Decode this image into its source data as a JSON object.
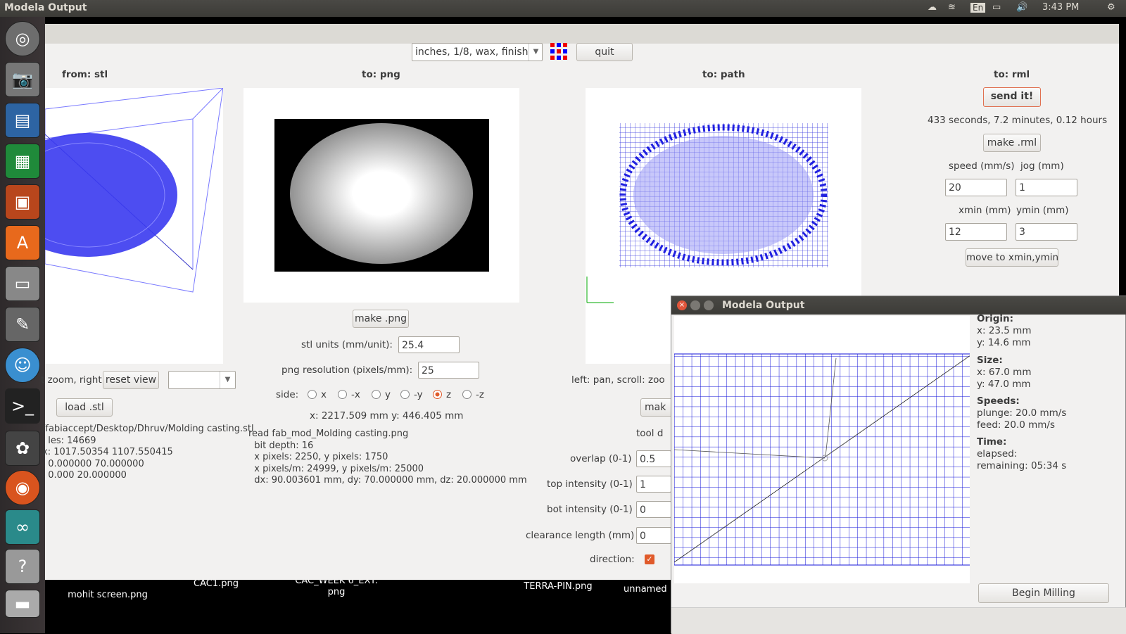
{
  "topbar": {
    "title": "Modela Output",
    "lang": "En",
    "time": "3:43 PM"
  },
  "main": {
    "top_select": "inches, 1/8, wax, finish",
    "quit": "quit",
    "col_stl": "from: stl",
    "col_png": "to: png",
    "col_path": "to: path",
    "col_rml": "to: rml",
    "stl": {
      "rotate_hint": "t zoom, right: rotate",
      "reset_view": "reset view",
      "load": "load .stl",
      "info_lines": [
        "/fabiaccept/Desktop/Dhruv/Molding casting.stl",
        "  les: 14669",
        "x: 1017.50354 1107.550415",
        "  0.000000 70.000000",
        "  0.000 20.000000"
      ]
    },
    "png": {
      "make": "make .png",
      "units_label": "stl units (mm/unit):",
      "units_value": "25.4",
      "res_label": "png resolution (pixels/mm):",
      "res_value": "25",
      "side_label": "side:",
      "sides": [
        "x",
        "-x",
        "y",
        "-y",
        "z",
        "-z"
      ],
      "coords": "x: 2217.509 mm  y: 446.405 mm",
      "info_lines": [
        "read fab_mod_Molding casting.png",
        "  bit depth: 16",
        "  x pixels: 2250, y pixels: 1750",
        "  x pixels/m: 24999, y pixels/m: 25000",
        "  dx: 90.003601 mm, dy: 70.000000 mm, dz: 20.000000 mm"
      ]
    },
    "path": {
      "hint": "left: pan, scroll: zoo",
      "make": "mak",
      "tool": "tool d",
      "overlap_label": "overlap (0-1)",
      "overlap": "0.5",
      "top_label": "top intensity (0-1)",
      "top": "1",
      "bot_label": "bot intensity (0-1)",
      "bot": "0",
      "clear_label": "clearance length (mm)",
      "clear": "0",
      "dir_label": "direction:"
    },
    "rml": {
      "send": "send it!",
      "time": "433 seconds, 7.2 minutes, 0.12 hours",
      "make": "make .rml",
      "speed_label": "speed (mm/s)",
      "jog_label": "jog (mm)",
      "speed": "20",
      "jog": "1",
      "xmin_label": "xmin (mm)",
      "ymin_label": "ymin (mm)",
      "xmin": "12",
      "ymin": "3",
      "move": "move to xmin,ymin"
    }
  },
  "popup": {
    "title": "Modela Output",
    "origin_h": "Origin:",
    "origin_x": "x: 23.5 mm",
    "origin_y": "y: 14.6 mm",
    "size_h": "Size:",
    "size_x": "x: 67.0 mm",
    "size_y": "y: 47.0 mm",
    "speeds_h": "Speeds:",
    "plunge": "plunge: 20.0 mm/s",
    "feed": "feed: 20.0 mm/s",
    "time_h": "Time:",
    "elapsed": "elapsed:",
    "remaining": "remaining: 05:34 s",
    "begin": "Begin Milling"
  },
  "desktop": [
    "mohit screen.png",
    "CAC1.png",
    "CAC_WEEK 6_EXT.\npng",
    "TERRA-PIN.png",
    "unnamed"
  ]
}
